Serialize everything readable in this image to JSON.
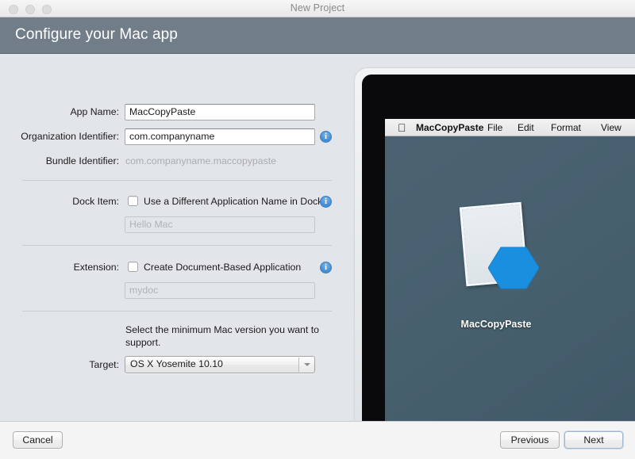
{
  "window": {
    "title": "New Project",
    "traffic_lights": [
      "close",
      "minimize",
      "maximize"
    ]
  },
  "header": {
    "title": "Configure your Mac app",
    "background": "#717d89"
  },
  "form": {
    "app_name": {
      "label": "App Name:",
      "value": "MacCopyPaste"
    },
    "organization_identifier": {
      "label": "Organization Identifier:",
      "value": "com.companyname",
      "info": "i"
    },
    "bundle_identifier": {
      "label": "Bundle Identifier:",
      "value": "com.companyname.maccopypaste"
    },
    "dock_item": {
      "label": "Dock Item:",
      "checkbox_label": "Use a Different Application Name in Dock",
      "checked": false,
      "placeholder": "Hello Mac",
      "info": "i"
    },
    "extension": {
      "label": "Extension:",
      "checkbox_label": "Create Document-Based Application",
      "checked": false,
      "placeholder": "mydoc",
      "info": "i"
    },
    "target": {
      "help_text": "Select the minimum Mac version you want to support.",
      "label": "Target:",
      "value": "OS X Yosemite 10.10"
    }
  },
  "preview": {
    "menubar": {
      "apple": "",
      "items": [
        "MacCopyPaste",
        "File",
        "Edit",
        "Format",
        "View"
      ]
    },
    "desktop_icon_label": "MacCopyPaste",
    "desktop_color": "#47606e",
    "hexagon_color": "#1a8fe0"
  },
  "footer": {
    "cancel": "Cancel",
    "previous": "Previous",
    "next": "Next"
  }
}
